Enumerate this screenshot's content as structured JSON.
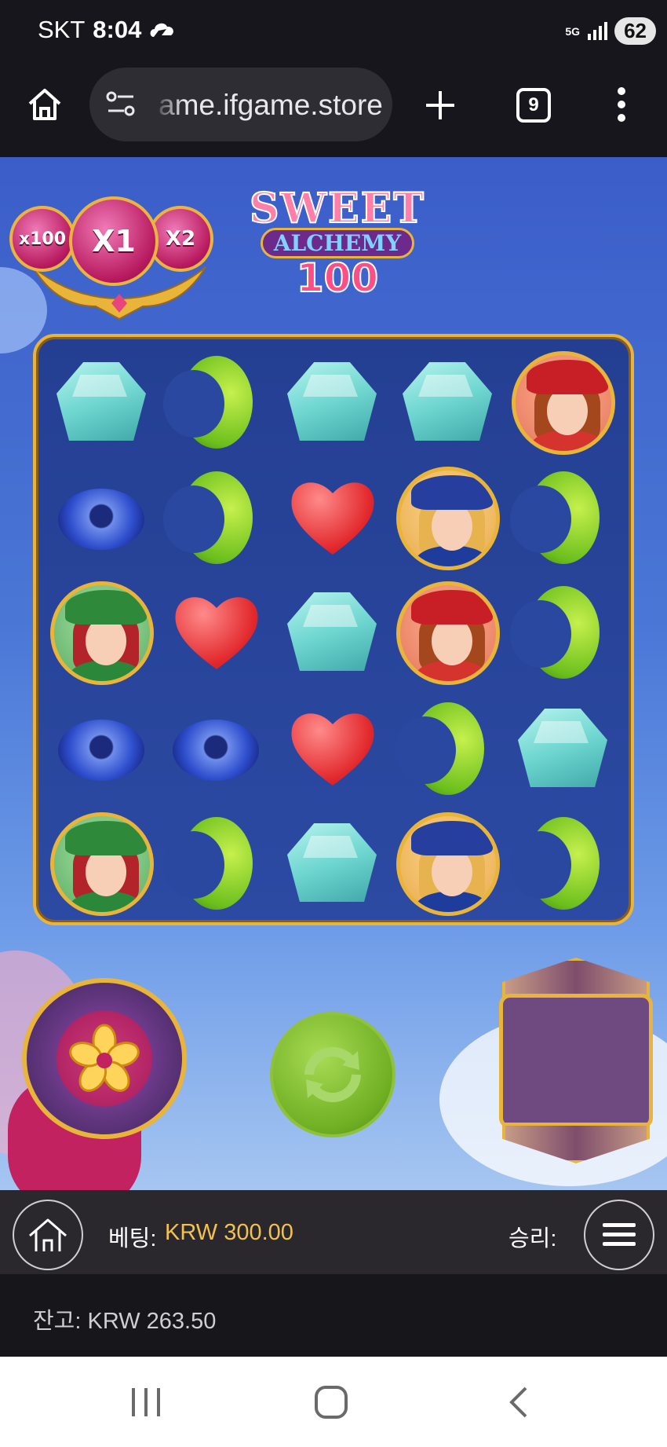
{
  "status_bar": {
    "carrier": "SKT",
    "time": "8:04",
    "network": "5G",
    "battery": "62"
  },
  "browser": {
    "url": "ame.ifgame.store",
    "tab_count": "9"
  },
  "game": {
    "logo": {
      "line1": "SWEET",
      "line2": "ALCHEMY",
      "line3": "100"
    },
    "multipliers": [
      "x100",
      "X1",
      "X2"
    ],
    "grid": [
      [
        "gem",
        "bean",
        "gem",
        "gem",
        "portrait-red"
      ],
      [
        "ring",
        "bean",
        "heart",
        "portrait-blue",
        "bean"
      ],
      [
        "portrait-green",
        "heart",
        "gem",
        "portrait-red",
        "bean"
      ],
      [
        "ring",
        "ring",
        "heart",
        "bean",
        "gem"
      ],
      [
        "portrait-green",
        "bean",
        "gem",
        "portrait-blue",
        "bean"
      ]
    ]
  },
  "controls": {
    "bet_label": "베팅:",
    "bet_value": "KRW 300.00",
    "win_label": "승리:",
    "balance": "잔고: KRW 263.50"
  },
  "colors": {
    "accent_gold": "#e8b43a",
    "bet_value": "#f2c14e",
    "spin_green": "#6fae22"
  }
}
